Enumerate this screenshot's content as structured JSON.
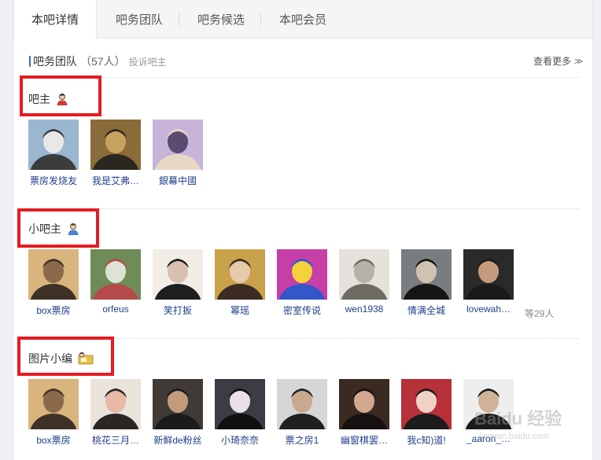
{
  "tabs": [
    "本吧详情",
    "吧务团队",
    "吧务候选",
    "本吧会员"
  ],
  "header": {
    "title": "吧务团队",
    "count": "（57人）",
    "report": "投诉吧主",
    "more": "查看更多"
  },
  "sections": [
    {
      "role": "吧主",
      "icon": "owner-person-icon",
      "members": [
        {
          "name": "票房发烧友",
          "colors": [
            "#9bb6cf",
            "#3a3c3e",
            "#e8e8e8"
          ]
        },
        {
          "name": "我是艾弗…",
          "colors": [
            "#8a6b3a",
            "#2a2620",
            "#c7a15e"
          ]
        },
        {
          "name": "銀幕中國",
          "colors": [
            "#c7b4d8",
            "#e9d7c6",
            "#5b4b72"
          ]
        }
      ]
    },
    {
      "role": "小吧主",
      "icon": "deputy-person-icon",
      "members": [
        {
          "name": "box票房",
          "colors": [
            "#d9b47c",
            "#3e3126",
            "#8a6a4a"
          ]
        },
        {
          "name": "orfeus",
          "colors": [
            "#6f8b58",
            "#b54a4a",
            "#dfe3d6"
          ]
        },
        {
          "name": "笑打扳",
          "colors": [
            "#f1ece6",
            "#1e1e1e",
            "#d9bfae"
          ]
        },
        {
          "name": "幂瑶",
          "colors": [
            "#c9a14a",
            "#3b2b20",
            "#e6c9a8"
          ]
        },
        {
          "name": "密室传说",
          "colors": [
            "#c63ea8",
            "#3356c9",
            "#f4d23b"
          ]
        },
        {
          "name": "wen1938",
          "colors": [
            "#e5e2dc",
            "#6e6a64",
            "#b7b2a8"
          ]
        },
        {
          "name": "情满全城",
          "colors": [
            "#7a7d80",
            "#151515",
            "#d0c2b0"
          ]
        },
        {
          "name": "lovewah…",
          "colors": [
            "#2a2a2a",
            "#1a1a1a",
            "#c49a7c"
          ]
        }
      ],
      "extra": "等29人"
    },
    {
      "role": "图片小编",
      "icon": "editor-image-icon",
      "members": [
        {
          "name": "box票房",
          "colors": [
            "#d9b47c",
            "#3e3126",
            "#8a6a4a"
          ]
        },
        {
          "name": "桃花三月…",
          "colors": [
            "#e9e3dc",
            "#2b2622",
            "#e8b9a6"
          ]
        },
        {
          "name": "新鲜de粉丝",
          "colors": [
            "#3f3a36",
            "#1b1b1b",
            "#c49a7c"
          ]
        },
        {
          "name": "小琦奈奈",
          "colors": [
            "#3c3d44",
            "#101012",
            "#e7e1e6"
          ]
        },
        {
          "name": "票之房1",
          "colors": [
            "#d6d6d6",
            "#202020",
            "#c9a890"
          ]
        },
        {
          "name": "幽窗棋罢…",
          "colors": [
            "#3a2a22",
            "#171010",
            "#d2a890"
          ]
        },
        {
          "name": "我c知)道!",
          "colors": [
            "#b7303a",
            "#1c1c1c",
            "#f0d2c4"
          ]
        },
        {
          "name": "_aaron_…",
          "colors": [
            "#eeeeee",
            "#1c1c1c",
            "#d0b298"
          ]
        }
      ]
    }
  ],
  "watermark": "Baidu 经验",
  "watermark_sub": "jingyan.baidu.com",
  "colors": {
    "accent": "#3b6fc8",
    "highlight": "#e41c23",
    "link": "#1f3f8a"
  }
}
